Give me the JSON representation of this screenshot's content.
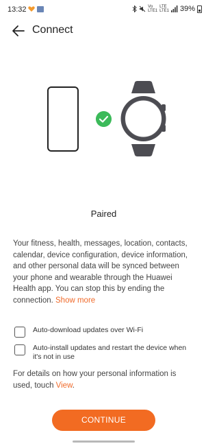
{
  "status_bar": {
    "time": "13:32",
    "network_top": "Vo",
    "network_bottom": "LTE1",
    "lte_top": "LTE",
    "lte_bottom": "LTE1",
    "battery": "39%"
  },
  "header": {
    "title": "Connect"
  },
  "illustration": {
    "check_color": "#3cba5a"
  },
  "status": {
    "label": "Paired"
  },
  "description": {
    "text": "Your fitness, health, messages, location, contacts, calendar, device configuration, device information, and other personal data will be synced between your phone and wearable through the Huawei Health app. You can stop this by ending the connection. ",
    "link": "Show more"
  },
  "options": [
    {
      "label": "Auto-download updates over Wi-Fi",
      "checked": false
    },
    {
      "label": "Auto-install updates and restart the device when it's not in use",
      "checked": false
    }
  ],
  "details": {
    "text": "For details on how your personal information is used, touch ",
    "link": "View",
    "suffix": "."
  },
  "actions": {
    "continue_label": "CONTINUE"
  },
  "colors": {
    "accent": "#f26b22",
    "link": "#f06a2a"
  }
}
